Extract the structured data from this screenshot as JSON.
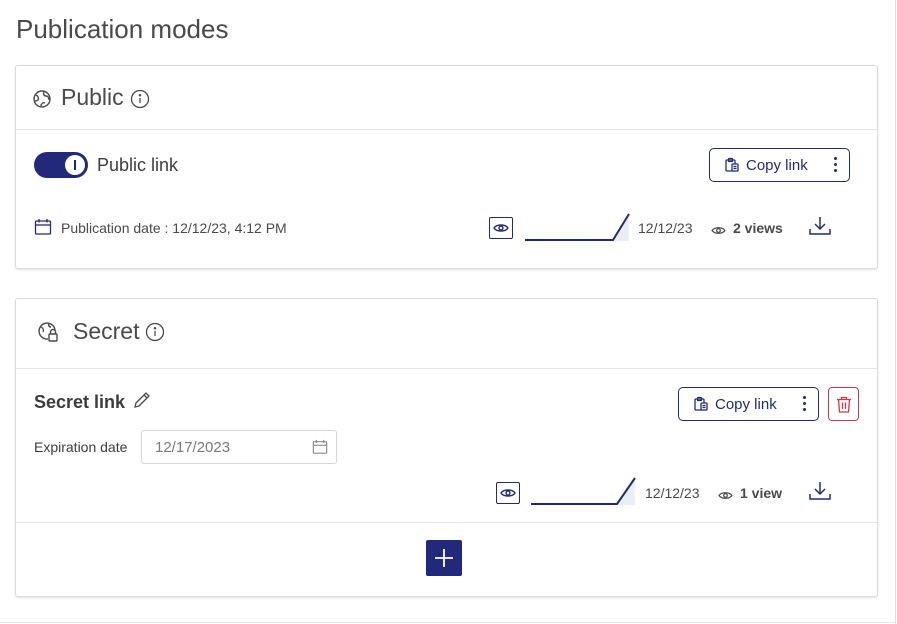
{
  "page": {
    "title": "Publication modes"
  },
  "public": {
    "title": "Public",
    "toggle_label": "Public link",
    "toggle_on": true,
    "copy_link_label": "Copy link",
    "publication_date_text": "Publication date : 12/12/23, 4:12 PM",
    "stats": {
      "date": "12/12/23",
      "views": "2 views"
    }
  },
  "secret": {
    "title": "Secret",
    "link_name": "Secret link",
    "copy_link_label": "Copy link",
    "expiration_label": "Expiration date",
    "expiration_value": "12/17/2023",
    "stats": {
      "date": "12/12/23",
      "views": "1 view"
    }
  },
  "colors": {
    "primary": "#23297a",
    "danger": "#d0374b",
    "border": "#dcdcdc",
    "text": "#4a4a4a"
  },
  "icons": {
    "public_section": "globe-icon",
    "secret_section": "globe-lock-icon",
    "info": "info-icon",
    "copy": "clipboard-icon",
    "more": "more-vertical-icon",
    "calendar": "calendar-icon",
    "eye": "eye-icon",
    "download": "download-icon",
    "edit": "pencil-icon",
    "delete": "trash-icon",
    "add": "plus-icon"
  }
}
